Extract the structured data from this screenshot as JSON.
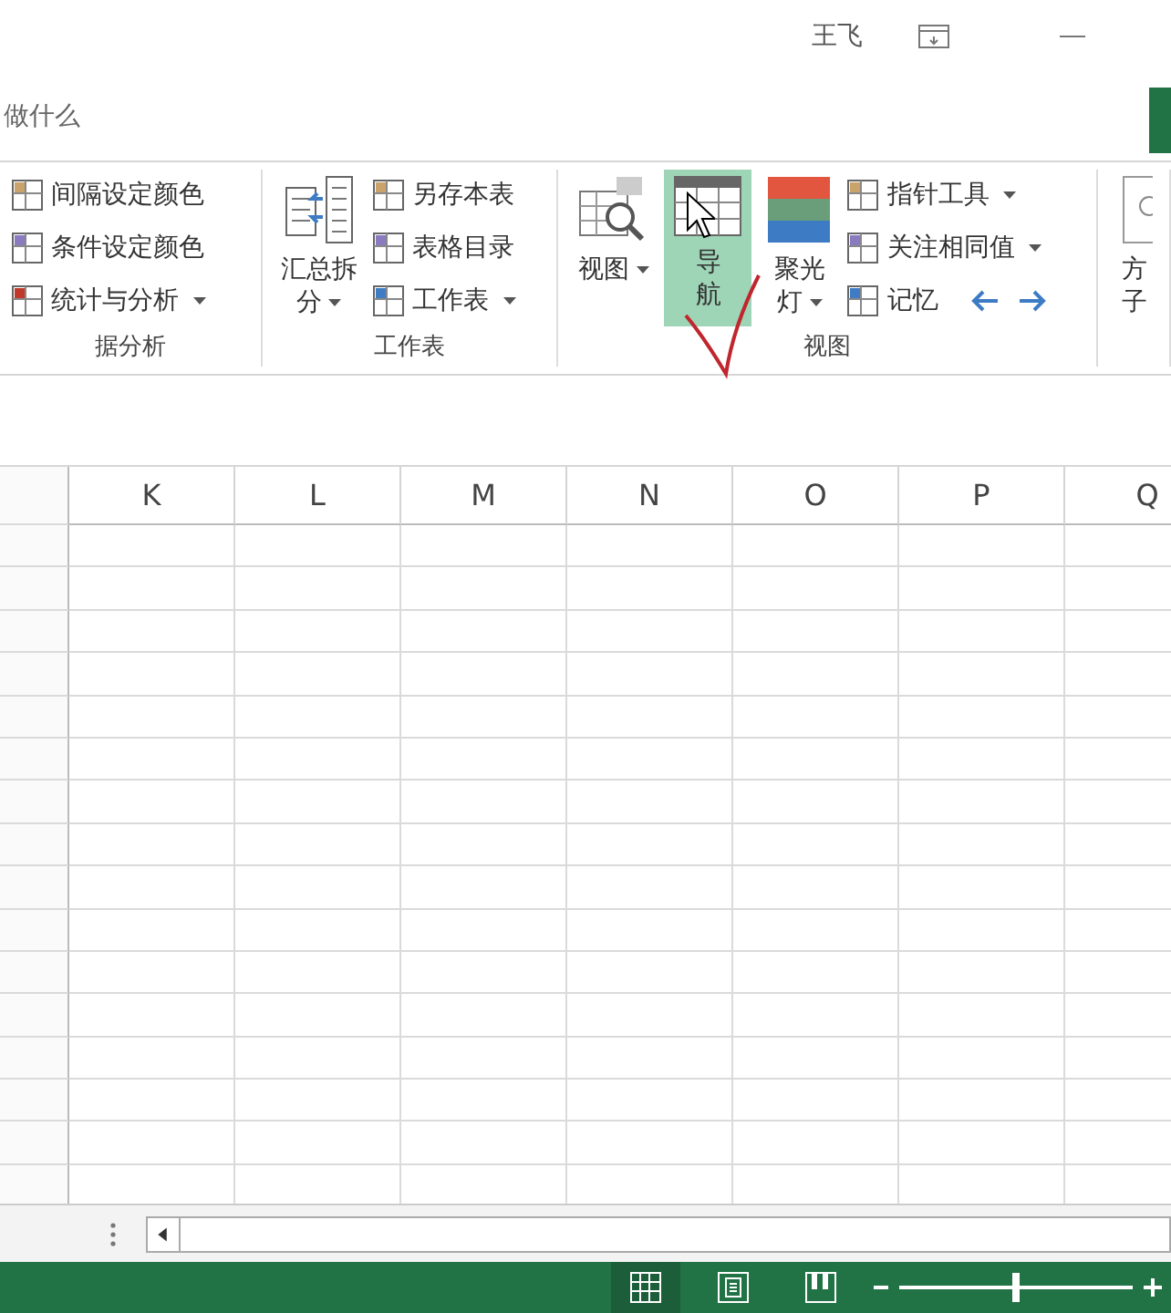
{
  "title_bar": {
    "user": "王飞"
  },
  "tell_me": "做什么",
  "ribbon": {
    "groups": [
      {
        "label": "据分析",
        "small": [
          {
            "label": "间隔设定颜色",
            "dropdown": false
          },
          {
            "label": "条件设定颜色",
            "dropdown": false
          },
          {
            "label": "统计与分析",
            "dropdown": true
          }
        ]
      },
      {
        "label": "工作表",
        "large": [
          {
            "lines": [
              "汇总拆",
              "分"
            ],
            "dropdown": true,
            "selected": false,
            "kind": "split"
          }
        ],
        "small": [
          {
            "label": "另存本表",
            "dropdown": false
          },
          {
            "label": "表格目录",
            "dropdown": false
          },
          {
            "label": "工作表",
            "dropdown": true
          }
        ]
      },
      {
        "label": "视图",
        "large": [
          {
            "lines": [
              "视图"
            ],
            "dropdown": true,
            "selected": false,
            "kind": "view"
          },
          {
            "lines": [
              "导",
              "航"
            ],
            "dropdown": false,
            "selected": true,
            "kind": "nav"
          },
          {
            "lines": [
              "聚光",
              "灯"
            ],
            "dropdown": true,
            "selected": false,
            "kind": "spot"
          }
        ],
        "small": [
          {
            "label": "指针工具",
            "dropdown": true
          },
          {
            "label": "关注相同值",
            "dropdown": true
          },
          {
            "label": "记忆",
            "dropdown": false
          }
        ]
      },
      {
        "large": [
          {
            "lines": [
              "方",
              "子"
            ],
            "dropdown": false,
            "selected": false,
            "kind": "cut"
          }
        ]
      }
    ]
  },
  "columns": [
    "K",
    "L",
    "M",
    "N",
    "O",
    "P",
    "Q"
  ],
  "status_bar": {
    "views": [
      {
        "kind": "normal",
        "selected": true
      },
      {
        "kind": "layout",
        "selected": false
      },
      {
        "kind": "break",
        "selected": false
      }
    ],
    "zoom": {
      "level": 0.5
    }
  }
}
